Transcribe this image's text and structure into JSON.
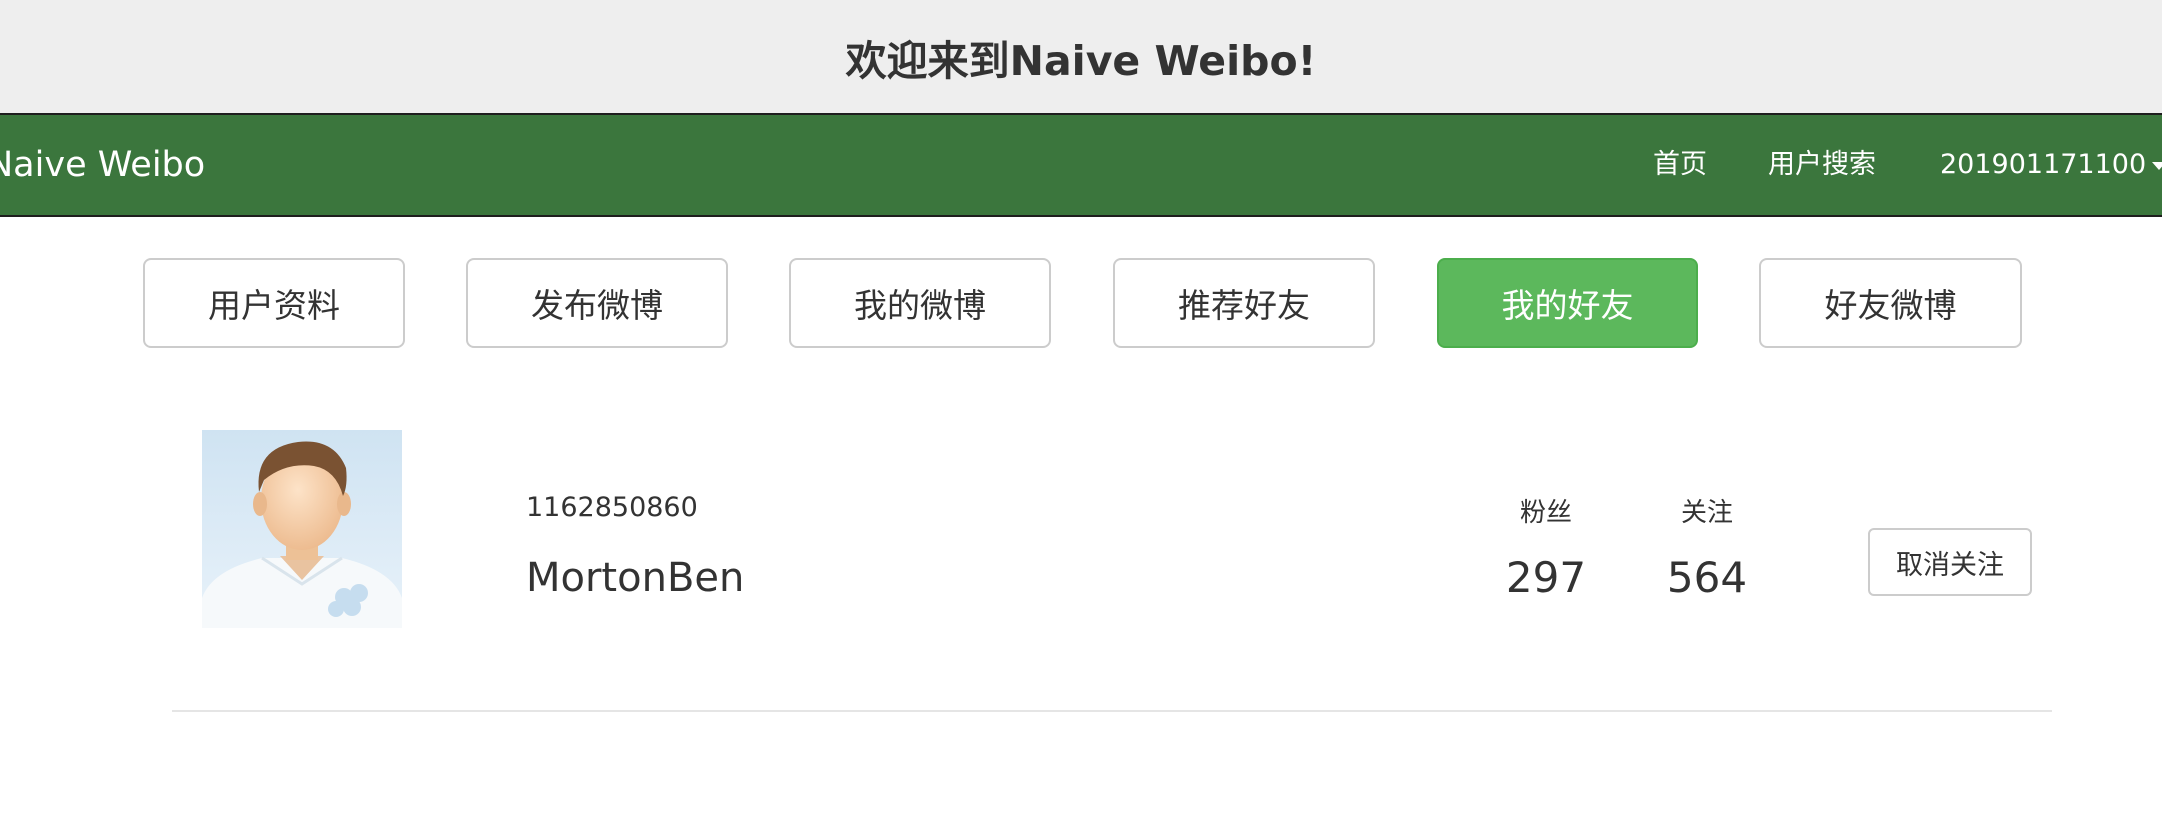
{
  "header": {
    "welcome_text": "欢迎来到Naive Weibo!"
  },
  "navbar": {
    "brand": "Naive Weibo",
    "home": "首页",
    "user_search": "用户搜索",
    "user": "201901171100"
  },
  "tabs": [
    {
      "label": "用户资料"
    },
    {
      "label": "发布微博"
    },
    {
      "label": "我的微博"
    },
    {
      "label": "推荐好友"
    },
    {
      "label": "我的好友",
      "active": true
    },
    {
      "label": "好友微博"
    }
  ],
  "friend": {
    "id": "1162850860",
    "name": "MortonBen",
    "followers_label": "粉丝",
    "followers": "297",
    "following_label": "关注",
    "following": "564",
    "unfollow_label": "取消关注"
  },
  "colors": {
    "navbar": "#3b763d",
    "active_tab": "#5cb85c",
    "header_bg": "#eeeeee"
  }
}
